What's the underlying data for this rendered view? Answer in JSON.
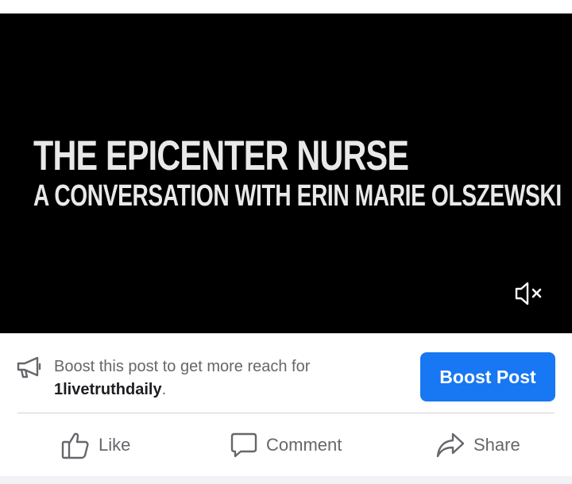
{
  "video": {
    "title": "THE EPICENTER NURSE",
    "subtitle": "A CONVERSATION WITH ERIN MARIE OLSZEWSKI",
    "mute_icon": "speaker-muted-icon"
  },
  "boost": {
    "icon": "megaphone-icon",
    "text_prefix": "Boost this post to get more reach for",
    "page_name": "1livetruthdaily",
    "text_suffix": ".",
    "button_label": "Boost Post",
    "button_color": "#1877f2"
  },
  "actions": {
    "like": {
      "label": "Like",
      "icon": "thumbs-up-icon"
    },
    "comment": {
      "label": "Comment",
      "icon": "comment-icon"
    },
    "share": {
      "label": "Share",
      "icon": "share-icon"
    }
  }
}
